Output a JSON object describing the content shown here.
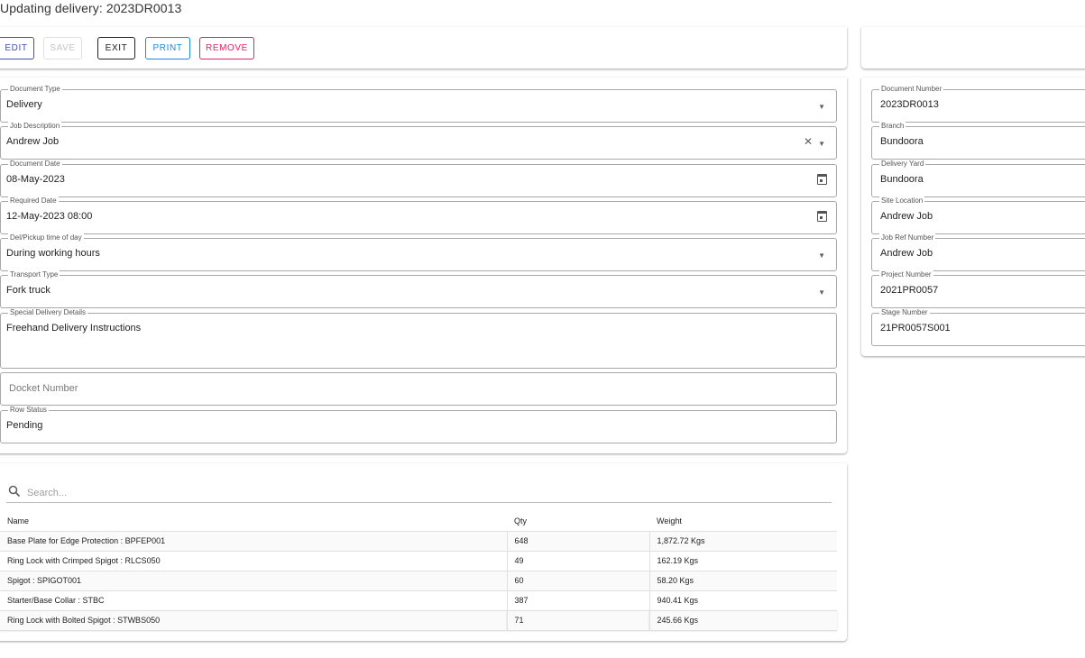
{
  "page": {
    "title": "Updating delivery: 2023DR0013"
  },
  "toolbar": {
    "edit_label": "EDIT",
    "save_label": "SAVE",
    "exit_label": "EXIT",
    "print_label": "PRINT",
    "remove_label": "REMOVE"
  },
  "form": {
    "document_type": {
      "label": "Document Type",
      "value": "Delivery"
    },
    "job_description": {
      "label": "Job Description",
      "value": "Andrew Job"
    },
    "document_date": {
      "label": "Document Date",
      "value": "08-May-2023"
    },
    "required_date": {
      "label": "Required Date",
      "value": "12-May-2023 08:00"
    },
    "pickup_time": {
      "label": "Del/Pickup time of day",
      "value": "During working hours"
    },
    "transport_type": {
      "label": "Transport Type",
      "value": "Fork truck"
    },
    "special_details": {
      "label": "Special Delivery Details",
      "value": "Freehand Delivery Instructions"
    },
    "docket_number": {
      "placeholder": "Docket Number",
      "value": ""
    },
    "row_status": {
      "label": "Row Status",
      "value": "Pending"
    }
  },
  "info": {
    "document_number": {
      "label": "Document Number",
      "value": "2023DR0013"
    },
    "branch": {
      "label": "Branch",
      "value": "Bundoora"
    },
    "delivery_yard": {
      "label": "Delivery Yard",
      "value": "Bundoora"
    },
    "site_location": {
      "label": "Site Location",
      "value": "Andrew Job"
    },
    "job_ref_number": {
      "label": "Job Ref Number",
      "value": "Andrew Job"
    },
    "project_number": {
      "label": "Project Number",
      "value": "2021PR0057"
    },
    "stage_number": {
      "label": "Stage Number",
      "value": "21PR0057S001"
    }
  },
  "search": {
    "placeholder": "Search..."
  },
  "table": {
    "headers": {
      "name": "Name",
      "qty": "Qty",
      "weight": "Weight"
    },
    "rows": [
      {
        "name": "Base Plate for Edge Protection : BPFEP001",
        "qty": "648",
        "weight": "1,872.72 Kgs"
      },
      {
        "name": "Ring Lock with Crimped Spigot : RLCS050",
        "qty": "49",
        "weight": "162.19 Kgs"
      },
      {
        "name": "Spigot : SPIGOT001",
        "qty": "60",
        "weight": "58.20 Kgs"
      },
      {
        "name": "Starter/Base Collar : STBC",
        "qty": "387",
        "weight": "940.41 Kgs"
      },
      {
        "name": "Ring Lock with Bolted Spigot : STWBS050",
        "qty": "71",
        "weight": "245.66 Kgs"
      }
    ]
  },
  "icons": {
    "dropdown": "caret-down-icon",
    "clear": "close-icon",
    "calendar": "calendar-icon",
    "search": "search-icon"
  },
  "colors": {
    "edit": "#3f51b5",
    "print": "#1e88e5",
    "remove": "#e91e63",
    "save_disabled": "#c4c4c4"
  }
}
